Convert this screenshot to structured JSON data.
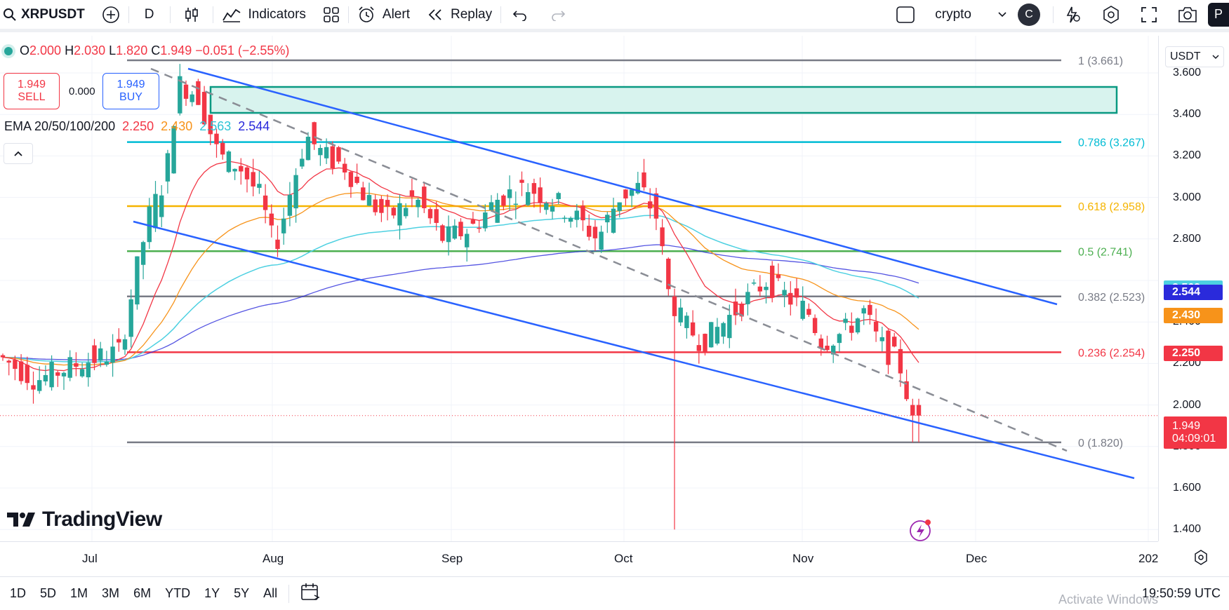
{
  "toolbar": {
    "symbol": "XRPUSDT",
    "interval": "D",
    "indicators_label": "Indicators",
    "alert_label": "Alert",
    "replay_label": "Replay",
    "layout_name": "crypto",
    "avatar_letter": "C",
    "publish_letter": "P"
  },
  "legend": {
    "open_key": "O",
    "open": "2.000",
    "high_key": "H",
    "high": "2.030",
    "low_key": "L",
    "low": "1.820",
    "close_key": "C",
    "close": "1.949",
    "change": "−0.051 (−2.55%)"
  },
  "trade": {
    "sell_price": "1.949",
    "sell_label": "SELL",
    "spread": "0.000",
    "buy_price": "1.949",
    "buy_label": "BUY"
  },
  "ema": {
    "name": "EMA 20/50/100/200",
    "v20": "2.250",
    "v50": "2.430",
    "v100": "2.563",
    "v200": "2.544",
    "c20": "#f23645",
    "c50": "#f7931a",
    "c100": "#4dd0e1",
    "c200": "#2a2adb"
  },
  "fib": [
    {
      "label": "1 (3.661)",
      "price": 3.661,
      "color": "#787b86"
    },
    {
      "label": "0.786 (3.267)",
      "price": 3.267,
      "color": "#00bcd4"
    },
    {
      "label": "0.618 (2.958)",
      "price": 2.958,
      "color": "#f5b400"
    },
    {
      "label": "0.5 (2.741)",
      "price": 2.741,
      "color": "#4caf50"
    },
    {
      "label": "0.382 (2.523)",
      "price": 2.523,
      "color": "#787b86"
    },
    {
      "label": "0.236 (2.254)",
      "price": 2.254,
      "color": "#f23645"
    },
    {
      "label": "0 (1.820)",
      "price": 1.82,
      "color": "#787b86"
    }
  ],
  "price_scale": {
    "currency": "USDT",
    "ticks": [
      "3.600",
      "3.400",
      "3.200",
      "3.000",
      "2.800",
      "2.400",
      "2.200",
      "2.000",
      "1.800",
      "1.600",
      "1.400"
    ],
    "tags": [
      {
        "value": "2.563",
        "price": 2.563,
        "color": "#4dd0e1"
      },
      {
        "value": "2.544",
        "price": 2.544,
        "color": "#2a2adb"
      },
      {
        "value": "2.430",
        "price": 2.43,
        "color": "#f7931a"
      },
      {
        "value": "2.250",
        "price": 2.25,
        "color": "#f23645"
      }
    ],
    "current_price": "1.949",
    "countdown": "04:09:01"
  },
  "time_axis": {
    "labels": [
      "Jul",
      "Aug",
      "Sep",
      "Oct",
      "Nov",
      "Dec",
      "202"
    ]
  },
  "bottom": {
    "ranges": [
      "1D",
      "5D",
      "1M",
      "3M",
      "6M",
      "YTD",
      "1Y",
      "5Y",
      "All"
    ],
    "clock": "19:50:59 UTC"
  },
  "watermark": "TradingView",
  "os_watermark": "Activate Windows",
  "colors": {
    "up": "#26a69a",
    "down": "#f23645",
    "channel": "#2962ff",
    "zone": "#d8f3ee",
    "zone_border": "#089981"
  }
}
